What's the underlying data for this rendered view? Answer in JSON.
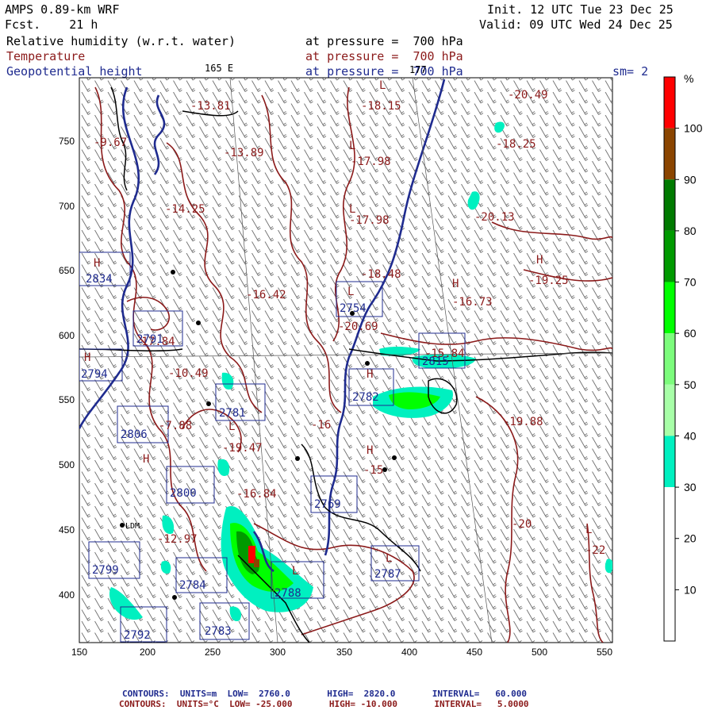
{
  "header": {
    "model": "AMPS 0.89-km WRF",
    "forecast": "Fcst.    21 h",
    "init": "Init. 12 UTC Tue 23 Dec 25",
    "valid": "Valid: 09 UTC Wed 24 Dec 25",
    "field_rh": "Relative humidity (w.r.t. water)",
    "field_temp": "Temperature",
    "field_geo": "Geopotential height",
    "pressure_rh": "at pressure =  700 hPa",
    "pressure_temp": "at pressure =  700 hPa",
    "pressure_geo": "at pressure =  700 hPa",
    "lon_label": "165 E",
    "lat_label": "177",
    "smoothing": "sm= 2"
  },
  "axes": {
    "x_ticks": [
      "150",
      "200",
      "250",
      "300",
      "350",
      "400",
      "450",
      "500",
      "550"
    ],
    "y_ticks": [
      "750",
      "700",
      "650",
      "600",
      "550",
      "500",
      "450",
      "400"
    ]
  },
  "colorbar": {
    "unit": "%",
    "labels": [
      "100",
      "90",
      "80",
      "70",
      "60",
      "50",
      "40",
      "30",
      "20",
      "10"
    ],
    "colors": [
      "#ff0000",
      "#8b4500",
      "#007a00",
      "#009a00",
      "#00ff00",
      "#7cfc7c",
      "#a8ffa8",
      "#00f0c0",
      "#ffffff",
      "#ffffff",
      "#ffffff"
    ]
  },
  "map_labels": {
    "temperature": [
      {
        "text": "-18.15"
      },
      {
        "text": "-20.49"
      },
      {
        "text": "-9.67"
      },
      {
        "text": "-13.81"
      },
      {
        "text": "-13.89"
      },
      {
        "text": "-17.98"
      },
      {
        "text": "-18.25"
      },
      {
        "text": "-14.25"
      },
      {
        "text": "-17.98"
      },
      {
        "text": "-20.13"
      },
      {
        "text": "-18.48"
      },
      {
        "text": "-19.25"
      },
      {
        "text": "-16.42"
      },
      {
        "text": "-16.73"
      },
      {
        "text": "-20.69"
      },
      {
        "text": "-10.49"
      },
      {
        "text": "-19.88"
      },
      {
        "text": "-7.88"
      },
      {
        "text": "-19.47"
      },
      {
        "text": "-16.84"
      },
      {
        "text": "-12.97"
      },
      {
        "text": "-20"
      },
      {
        "text": "-22"
      },
      {
        "text": "-15"
      },
      {
        "text": "-16"
      },
      {
        "text": "-17.84"
      },
      {
        "text": "-15.84"
      }
    ],
    "height": [
      {
        "text": "2834"
      },
      {
        "text": "2754"
      },
      {
        "text": "2791"
      },
      {
        "text": "2794"
      },
      {
        "text": "2781"
      },
      {
        "text": "2806"
      },
      {
        "text": "2800"
      },
      {
        "text": "2799"
      },
      {
        "text": "2784"
      },
      {
        "text": "2788"
      },
      {
        "text": "2787"
      },
      {
        "text": "2792"
      },
      {
        "text": "2783"
      },
      {
        "text": "2769"
      },
      {
        "text": "2815"
      },
      {
        "text": "2782"
      }
    ],
    "highs_lows": [
      "L",
      "L",
      "L",
      "H",
      "H",
      "H",
      "L",
      "L",
      "H",
      "L",
      "H",
      "L",
      "H",
      "H",
      "L"
    ],
    "station": "LDM"
  },
  "footer": {
    "line1": "CONTOURS:  UNITS=m  LOW=  2760.0       HIGH=  2820.0       INTERVAL=   60.000",
    "line2": "CONTOURS:  UNITS=°C  LOW= -25.000       HIGH= -10.000       INTERVAL=   5.0000"
  }
}
